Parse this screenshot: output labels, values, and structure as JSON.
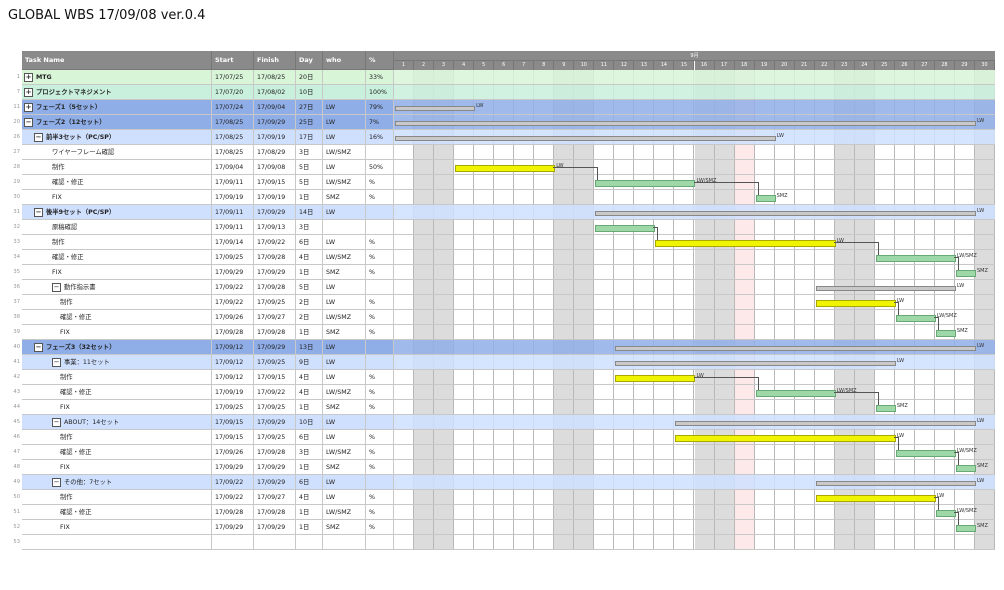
{
  "title": "GLOBAL WBS 17/09/08 ver.0.4",
  "header": {
    "task_name": "Task Name",
    "start": "Start",
    "finish": "Finish",
    "day": "Day",
    "who": "who",
    "percent": "%"
  },
  "chart": {
    "month": "9月",
    "days": [
      "1",
      "2",
      "3",
      "4",
      "5",
      "6",
      "7",
      "8",
      "9",
      "10",
      "11",
      "12",
      "13",
      "14",
      "15",
      "16",
      "17",
      "18",
      "19",
      "20",
      "21",
      "22",
      "23",
      "24",
      "25",
      "26",
      "27",
      "28",
      "29",
      "30"
    ]
  },
  "colors": {
    "mtg": "#d8f5d8",
    "project": "#c9f0dc",
    "phase": "#8faee8",
    "subphase": "#cfe0ff",
    "white": "#ffffff"
  },
  "rows": [
    {
      "num": "1",
      "label": "MTG",
      "start": "17/07/25",
      "finish": "17/08/25",
      "day": "20日",
      "who": "",
      "pct": "33%",
      "level": 0,
      "exp": true,
      "bg": "mtg"
    },
    {
      "num": "7",
      "label": "プロジェクトマネジメント",
      "start": "17/07/20",
      "finish": "17/08/02",
      "day": "10日",
      "who": "",
      "pct": "100%",
      "level": 0,
      "exp": true,
      "bg": "project"
    },
    {
      "num": "11",
      "label": "フェーズ1（5セット）",
      "start": "17/07/24",
      "finish": "17/09/04",
      "day": "27日",
      "who": "LW",
      "pct": "79%",
      "level": 0,
      "exp": true,
      "bg": "phase"
    },
    {
      "num": "20",
      "label": "フェーズ2（12セット）",
      "start": "17/08/25",
      "finish": "17/09/29",
      "day": "25日",
      "who": "LW",
      "pct": "7%",
      "level": 0,
      "exp": true,
      "bg": "phase"
    },
    {
      "num": "26",
      "label": "前半3セット（PC/SP）",
      "start": "17/08/25",
      "finish": "17/09/19",
      "day": "17日",
      "who": "LW",
      "pct": "16%",
      "level": 1,
      "exp": true,
      "bg": "subphase"
    },
    {
      "num": "27",
      "label": "ワイヤーフレーム確認",
      "start": "17/08/25",
      "finish": "17/08/29",
      "day": "3日",
      "who": "LW/SMZ",
      "pct": "",
      "level": 2,
      "exp": false,
      "bg": "white"
    },
    {
      "num": "28",
      "label": "制作",
      "start": "17/09/04",
      "finish": "17/09/08",
      "day": "5日",
      "who": "LW",
      "pct": "50%",
      "level": 2,
      "exp": false,
      "bg": "white"
    },
    {
      "num": "29",
      "label": "確認・修正",
      "start": "17/09/11",
      "finish": "17/09/15",
      "day": "5日",
      "who": "LW/SMZ",
      "pct": "%",
      "level": 2,
      "exp": false,
      "bg": "white"
    },
    {
      "num": "30",
      "label": "FIX",
      "start": "17/09/19",
      "finish": "17/09/19",
      "day": "1日",
      "who": "SMZ",
      "pct": "%",
      "level": 2,
      "exp": false,
      "bg": "white"
    },
    {
      "num": "31",
      "label": "後半9セット（PC/SP）",
      "start": "17/09/11",
      "finish": "17/09/29",
      "day": "14日",
      "who": "LW",
      "pct": "",
      "level": 1,
      "exp": true,
      "bg": "subphase"
    },
    {
      "num": "32",
      "label": "原稿確認",
      "start": "17/09/11",
      "finish": "17/09/13",
      "day": "3日",
      "who": "",
      "pct": "",
      "level": 2,
      "exp": false,
      "bg": "white"
    },
    {
      "num": "33",
      "label": "制作",
      "start": "17/09/14",
      "finish": "17/09/22",
      "day": "6日",
      "who": "LW",
      "pct": "%",
      "level": 2,
      "exp": false,
      "bg": "white"
    },
    {
      "num": "34",
      "label": "確認・修正",
      "start": "17/09/25",
      "finish": "17/09/28",
      "day": "4日",
      "who": "LW/SMZ",
      "pct": "%",
      "level": 2,
      "exp": false,
      "bg": "white"
    },
    {
      "num": "35",
      "label": "FIX",
      "start": "17/09/29",
      "finish": "17/09/29",
      "day": "1日",
      "who": "SMZ",
      "pct": "%",
      "level": 2,
      "exp": false,
      "bg": "white"
    },
    {
      "num": "36",
      "label": "動作指示書",
      "start": "17/09/22",
      "finish": "17/09/28",
      "day": "5日",
      "who": "LW",
      "pct": "",
      "level": 2,
      "exp": true,
      "bg": "white"
    },
    {
      "num": "37",
      "label": "制作",
      "start": "17/09/22",
      "finish": "17/09/25",
      "day": "2日",
      "who": "LW",
      "pct": "%",
      "level": 3,
      "exp": false,
      "bg": "white"
    },
    {
      "num": "38",
      "label": "確認・修正",
      "start": "17/09/26",
      "finish": "17/09/27",
      "day": "2日",
      "who": "LW/SMZ",
      "pct": "%",
      "level": 3,
      "exp": false,
      "bg": "white"
    },
    {
      "num": "39",
      "label": "FIX",
      "start": "17/09/28",
      "finish": "17/09/28",
      "day": "1日",
      "who": "SMZ",
      "pct": "%",
      "level": 3,
      "exp": false,
      "bg": "white"
    },
    {
      "num": "40",
      "label": "フェーズ3（32セット）",
      "start": "17/09/12",
      "finish": "17/09/29",
      "day": "13日",
      "who": "LW",
      "pct": "",
      "level": 1,
      "exp": true,
      "bg": "phase"
    },
    {
      "num": "41",
      "label": "事業：11セット",
      "start": "17/09/12",
      "finish": "17/09/25",
      "day": "9日",
      "who": "LW",
      "pct": "",
      "level": 2,
      "exp": true,
      "bg": "subphase"
    },
    {
      "num": "42",
      "label": "制作",
      "start": "17/09/12",
      "finish": "17/09/15",
      "day": "4日",
      "who": "LW",
      "pct": "%",
      "level": 3,
      "exp": false,
      "bg": "white"
    },
    {
      "num": "43",
      "label": "確認・修正",
      "start": "17/09/19",
      "finish": "17/09/22",
      "day": "4日",
      "who": "LW/SMZ",
      "pct": "%",
      "level": 3,
      "exp": false,
      "bg": "white"
    },
    {
      "num": "44",
      "label": "FIX",
      "start": "17/09/25",
      "finish": "17/09/25",
      "day": "1日",
      "who": "SMZ",
      "pct": "%",
      "level": 3,
      "exp": false,
      "bg": "white"
    },
    {
      "num": "45",
      "label": "ABOUT：14セット",
      "start": "17/09/15",
      "finish": "17/09/29",
      "day": "10日",
      "who": "LW",
      "pct": "",
      "level": 2,
      "exp": true,
      "bg": "subphase"
    },
    {
      "num": "46",
      "label": "制作",
      "start": "17/09/15",
      "finish": "17/09/25",
      "day": "6日",
      "who": "LW",
      "pct": "%",
      "level": 3,
      "exp": false,
      "bg": "white"
    },
    {
      "num": "47",
      "label": "確認・修正",
      "start": "17/09/26",
      "finish": "17/09/28",
      "day": "3日",
      "who": "LW/SMZ",
      "pct": "%",
      "level": 3,
      "exp": false,
      "bg": "white"
    },
    {
      "num": "48",
      "label": "FIX",
      "start": "17/09/29",
      "finish": "17/09/29",
      "day": "1日",
      "who": "SMZ",
      "pct": "%",
      "level": 3,
      "exp": false,
      "bg": "white"
    },
    {
      "num": "49",
      "label": "その他：7セット",
      "start": "17/09/22",
      "finish": "17/09/29",
      "day": "6日",
      "who": "LW",
      "pct": "",
      "level": 2,
      "exp": true,
      "bg": "subphase"
    },
    {
      "num": "50",
      "label": "制作",
      "start": "17/09/22",
      "finish": "17/09/27",
      "day": "4日",
      "who": "LW",
      "pct": "%",
      "level": 3,
      "exp": false,
      "bg": "white"
    },
    {
      "num": "51",
      "label": "確認・修正",
      "start": "17/09/28",
      "finish": "17/09/28",
      "day": "1日",
      "who": "LW/SMZ",
      "pct": "%",
      "level": 3,
      "exp": false,
      "bg": "white"
    },
    {
      "num": "52",
      "label": "FIX",
      "start": "17/09/29",
      "finish": "17/09/29",
      "day": "1日",
      "who": "SMZ",
      "pct": "%",
      "level": 3,
      "exp": false,
      "bg": "white"
    },
    {
      "num": "53",
      "label": "",
      "start": "",
      "finish": "",
      "day": "",
      "who": "",
      "pct": "",
      "level": 0,
      "exp": false,
      "bg": "white"
    }
  ],
  "bars": [
    {
      "row": 2,
      "kind": "summary",
      "d0": 1,
      "d1": 4,
      "label": "LW"
    },
    {
      "row": 3,
      "kind": "summary",
      "d0": 1,
      "d1": 29,
      "label": "LW"
    },
    {
      "row": 4,
      "kind": "summary",
      "d0": 1,
      "d1": 19,
      "label": "LW"
    },
    {
      "row": 6,
      "kind": "yellow",
      "d0": 4,
      "d1": 8,
      "label": "LW"
    },
    {
      "row": 7,
      "kind": "green",
      "d0": 11,
      "d1": 15,
      "label": "LW/SMZ"
    },
    {
      "row": 8,
      "kind": "green",
      "d0": 19,
      "d1": 19,
      "label": "SMZ"
    },
    {
      "row": 9,
      "kind": "summary",
      "d0": 11,
      "d1": 29,
      "label": "LW"
    },
    {
      "row": 10,
      "kind": "green",
      "d0": 11,
      "d1": 13,
      "label": ""
    },
    {
      "row": 11,
      "kind": "yellow",
      "d0": 14,
      "d1": 22,
      "label": "LW"
    },
    {
      "row": 12,
      "kind": "green",
      "d0": 25,
      "d1": 28,
      "label": "LW/SMZ"
    },
    {
      "row": 13,
      "kind": "green",
      "d0": 29,
      "d1": 29,
      "label": "SMZ"
    },
    {
      "row": 14,
      "kind": "summary",
      "d0": 22,
      "d1": 28,
      "label": "LW"
    },
    {
      "row": 15,
      "kind": "yellow",
      "d0": 22,
      "d1": 25,
      "label": "LW"
    },
    {
      "row": 16,
      "kind": "green",
      "d0": 26,
      "d1": 27,
      "label": "LW/SMZ"
    },
    {
      "row": 17,
      "kind": "green",
      "d0": 28,
      "d1": 28,
      "label": "SMZ"
    },
    {
      "row": 18,
      "kind": "summary",
      "d0": 12,
      "d1": 29,
      "label": "LW"
    },
    {
      "row": 19,
      "kind": "summary",
      "d0": 12,
      "d1": 25,
      "label": "LW"
    },
    {
      "row": 20,
      "kind": "yellow",
      "d0": 12,
      "d1": 15,
      "label": "LW"
    },
    {
      "row": 21,
      "kind": "green",
      "d0": 19,
      "d1": 22,
      "label": "LW/SMZ"
    },
    {
      "row": 22,
      "kind": "green",
      "d0": 25,
      "d1": 25,
      "label": "SMZ"
    },
    {
      "row": 23,
      "kind": "summary",
      "d0": 15,
      "d1": 29,
      "label": "LW"
    },
    {
      "row": 24,
      "kind": "yellow",
      "d0": 15,
      "d1": 25,
      "label": "LW"
    },
    {
      "row": 25,
      "kind": "green",
      "d0": 26,
      "d1": 28,
      "label": "LW/SMZ"
    },
    {
      "row": 26,
      "kind": "green",
      "d0": 29,
      "d1": 29,
      "label": "SMZ"
    },
    {
      "row": 27,
      "kind": "summary",
      "d0": 22,
      "d1": 29,
      "label": "LW"
    },
    {
      "row": 28,
      "kind": "yellow",
      "d0": 22,
      "d1": 27,
      "label": "LW"
    },
    {
      "row": 29,
      "kind": "green",
      "d0": 28,
      "d1": 28,
      "label": "LW/SMZ"
    },
    {
      "row": 30,
      "kind": "green",
      "d0": 29,
      "d1": 29,
      "label": "SMZ"
    }
  ],
  "weekend_days": [
    2,
    3,
    9,
    10,
    16,
    17,
    23,
    24,
    30
  ],
  "holiday_days": [
    18
  ]
}
